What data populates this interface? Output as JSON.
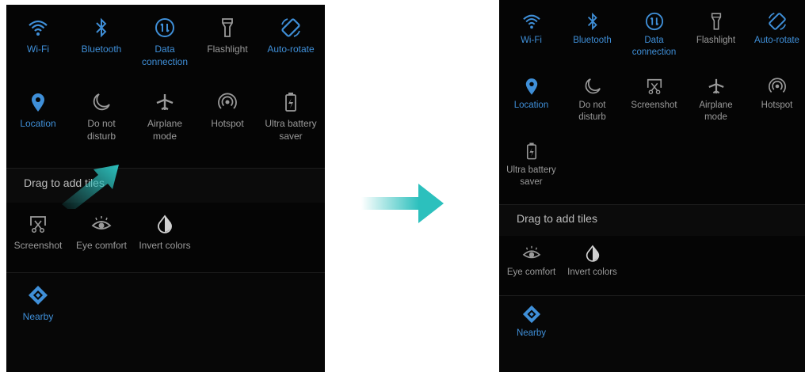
{
  "left_panel": {
    "active_tiles": [
      {
        "icon": "wifi-icon",
        "label": "Wi-Fi",
        "state": "on"
      },
      {
        "icon": "bluetooth-icon",
        "label": "Bluetooth",
        "state": "on"
      },
      {
        "icon": "data-connection-icon",
        "label": "Data\nconnection",
        "state": "on"
      },
      {
        "icon": "flashlight-icon",
        "label": "Flashlight",
        "state": "off"
      },
      {
        "icon": "auto-rotate-icon",
        "label": "Auto-rotate",
        "state": "on"
      },
      {
        "icon": "location-icon",
        "label": "Location",
        "state": "on"
      },
      {
        "icon": "moon-icon",
        "label": "Do not\ndisturb",
        "state": "off"
      },
      {
        "icon": "airplane-icon",
        "label": "Airplane\nmode",
        "state": "off"
      },
      {
        "icon": "hotspot-icon",
        "label": "Hotspot",
        "state": "off"
      },
      {
        "icon": "battery-saver-icon",
        "label": "Ultra battery\nsaver",
        "state": "off"
      }
    ],
    "drag_label": "Drag to add tiles",
    "inactive_tiles": [
      {
        "icon": "screenshot-icon",
        "label": "Screenshot"
      },
      {
        "icon": "eye-comfort-icon",
        "label": "Eye comfort"
      },
      {
        "icon": "invert-colors-icon",
        "label": "Invert colors"
      }
    ],
    "nearby_tile": {
      "icon": "nearby-icon",
      "label": "Nearby"
    }
  },
  "right_panel": {
    "active_tiles": [
      {
        "icon": "wifi-icon",
        "label": "Wi-Fi",
        "state": "on"
      },
      {
        "icon": "bluetooth-icon",
        "label": "Bluetooth",
        "state": "on"
      },
      {
        "icon": "data-connection-icon",
        "label": "Data\nconnection",
        "state": "on"
      },
      {
        "icon": "flashlight-icon",
        "label": "Flashlight",
        "state": "off"
      },
      {
        "icon": "auto-rotate-icon",
        "label": "Auto-rotate",
        "state": "on"
      },
      {
        "icon": "location-icon",
        "label": "Location",
        "state": "on"
      },
      {
        "icon": "moon-icon",
        "label": "Do not\ndisturb",
        "state": "off"
      },
      {
        "icon": "screenshot-icon",
        "label": "Screenshot",
        "state": "off"
      },
      {
        "icon": "airplane-icon",
        "label": "Airplane\nmode",
        "state": "off"
      },
      {
        "icon": "hotspot-icon",
        "label": "Hotspot",
        "state": "off"
      },
      {
        "icon": "battery-saver-icon",
        "label": "Ultra battery\nsaver",
        "state": "off"
      }
    ],
    "drag_label": "Drag to add tiles",
    "inactive_tiles": [
      {
        "icon": "eye-comfort-icon",
        "label": "Eye comfort"
      },
      {
        "icon": "invert-colors-icon",
        "label": "Invert colors"
      }
    ],
    "nearby_tile": {
      "icon": "nearby-icon",
      "label": "Nearby"
    }
  },
  "colors": {
    "active": "#3f8fd8",
    "inactive": "#9a9a9a",
    "arrow": "#2cc0bd",
    "panel": "#050505"
  }
}
